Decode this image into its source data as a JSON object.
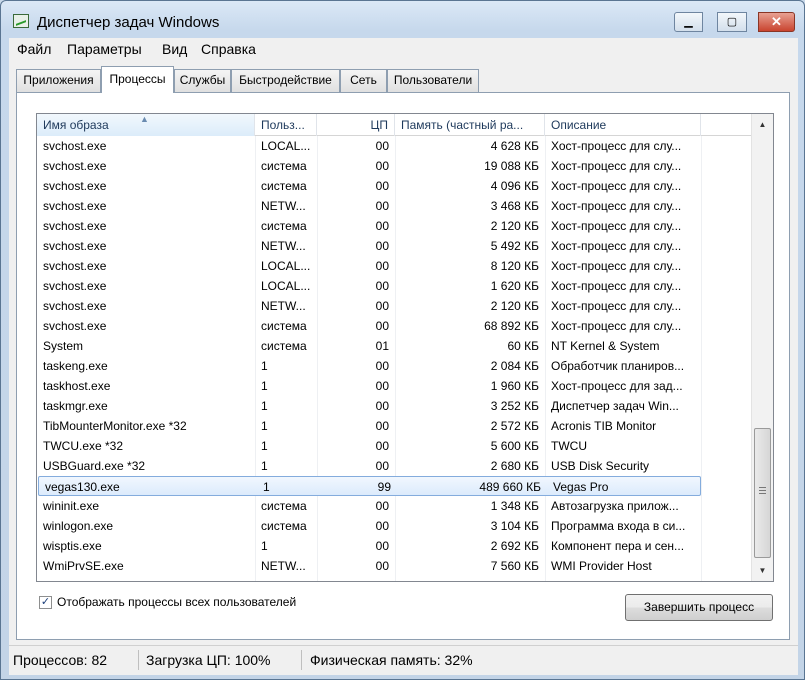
{
  "window": {
    "title": "Диспетчер задач Windows"
  },
  "title_buttons": {
    "minimize": "▁",
    "maximize": "▢",
    "close": "✕"
  },
  "menu": [
    "Файл",
    "Параметры",
    "Вид",
    "Справка"
  ],
  "tabs": [
    {
      "label": "Приложения",
      "active": false
    },
    {
      "label": "Процессы",
      "active": true
    },
    {
      "label": "Службы",
      "active": false
    },
    {
      "label": "Быстродействие",
      "active": false
    },
    {
      "label": "Сеть",
      "active": false
    },
    {
      "label": "Пользователи",
      "active": false
    }
  ],
  "columns": {
    "name": "Имя образа",
    "user": "Польз...",
    "cpu": "ЦП",
    "memory": "Память (частный ра...",
    "description": "Описание",
    "sort_indicator": "▲"
  },
  "rows": [
    {
      "name": "svchost.exe",
      "user": "LOCAL...",
      "cpu": "00",
      "mem": "4 628 КБ",
      "desc": "Хост-процесс для слу..."
    },
    {
      "name": "svchost.exe",
      "user": "система",
      "cpu": "00",
      "mem": "19 088 КБ",
      "desc": "Хост-процесс для слу..."
    },
    {
      "name": "svchost.exe",
      "user": "система",
      "cpu": "00",
      "mem": "4 096 КБ",
      "desc": "Хост-процесс для слу..."
    },
    {
      "name": "svchost.exe",
      "user": "NETW...",
      "cpu": "00",
      "mem": "3 468 КБ",
      "desc": "Хост-процесс для слу..."
    },
    {
      "name": "svchost.exe",
      "user": "система",
      "cpu": "00",
      "mem": "2 120 КБ",
      "desc": "Хост-процесс для слу..."
    },
    {
      "name": "svchost.exe",
      "user": "NETW...",
      "cpu": "00",
      "mem": "5 492 КБ",
      "desc": "Хост-процесс для слу..."
    },
    {
      "name": "svchost.exe",
      "user": "LOCAL...",
      "cpu": "00",
      "mem": "8 120 КБ",
      "desc": "Хост-процесс для слу..."
    },
    {
      "name": "svchost.exe",
      "user": "LOCAL...",
      "cpu": "00",
      "mem": "1 620 КБ",
      "desc": "Хост-процесс для слу..."
    },
    {
      "name": "svchost.exe",
      "user": "NETW...",
      "cpu": "00",
      "mem": "2 120 КБ",
      "desc": "Хост-процесс для слу..."
    },
    {
      "name": "svchost.exe",
      "user": "система",
      "cpu": "00",
      "mem": "68 892 КБ",
      "desc": "Хост-процесс для слу..."
    },
    {
      "name": "System",
      "user": "система",
      "cpu": "01",
      "mem": "60 КБ",
      "desc": "NT Kernel & System"
    },
    {
      "name": "taskeng.exe",
      "user": "1",
      "cpu": "00",
      "mem": "2 084 КБ",
      "desc": "Обработчик планиров..."
    },
    {
      "name": "taskhost.exe",
      "user": "1",
      "cpu": "00",
      "mem": "1 960 КБ",
      "desc": "Хост-процесс для зад..."
    },
    {
      "name": "taskmgr.exe",
      "user": "1",
      "cpu": "00",
      "mem": "3 252 КБ",
      "desc": "Диспетчер задач Win..."
    },
    {
      "name": "TibMounterMonitor.exe *32",
      "user": "1",
      "cpu": "00",
      "mem": "2 572 КБ",
      "desc": "Acronis TIB Monitor"
    },
    {
      "name": "TWCU.exe *32",
      "user": "1",
      "cpu": "00",
      "mem": "5 600 КБ",
      "desc": "TWCU"
    },
    {
      "name": "USBGuard.exe *32",
      "user": "1",
      "cpu": "00",
      "mem": "2 680 КБ",
      "desc": "USB Disk Security"
    },
    {
      "name": "vegas130.exe",
      "user": "1",
      "cpu": "99",
      "mem": "489 660 КБ",
      "desc": "Vegas Pro",
      "selected": true
    },
    {
      "name": "wininit.exe",
      "user": "система",
      "cpu": "00",
      "mem": "1 348 КБ",
      "desc": "Автозагрузка прилож..."
    },
    {
      "name": "winlogon.exe",
      "user": "система",
      "cpu": "00",
      "mem": "3 104 КБ",
      "desc": "Программа входа в си..."
    },
    {
      "name": "wisptis.exe",
      "user": "1",
      "cpu": "00",
      "mem": "2 692 КБ",
      "desc": "Компонент пера и сен..."
    },
    {
      "name": "WmiPrvSE.exe",
      "user": "NETW...",
      "cpu": "00",
      "mem": "7 560 КБ",
      "desc": "WMI Provider Host"
    }
  ],
  "scrollbar": {
    "up": "▲",
    "down": "▼"
  },
  "show_all_users": {
    "checked": true,
    "mark": "✓",
    "label": "Отображать процессы всех пользователей"
  },
  "end_process_button": "Завершить процесс",
  "status": {
    "processes": "Процессов: 82",
    "cpu": "Загрузка ЦП: 100%",
    "memory": "Физическая память: 32%"
  }
}
